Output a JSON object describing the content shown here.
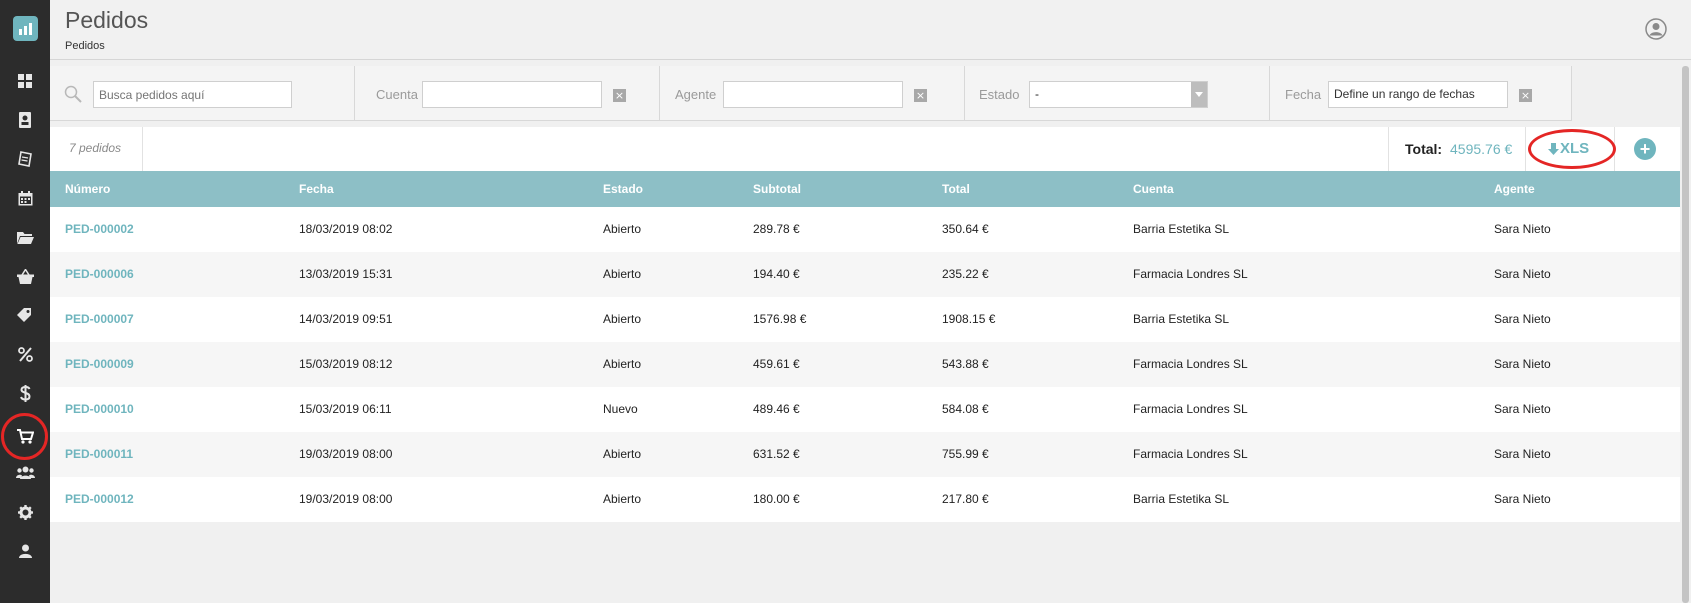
{
  "header": {
    "title": "Pedidos",
    "subtitle": "Pedidos"
  },
  "sidebar": {
    "items": [
      {
        "icon": "dashboard-icon"
      },
      {
        "icon": "contacts-icon"
      },
      {
        "icon": "notes-icon"
      },
      {
        "icon": "calendar-icon"
      },
      {
        "icon": "folder-icon"
      },
      {
        "icon": "basket-icon"
      },
      {
        "icon": "tag-icon"
      },
      {
        "icon": "percent-icon"
      },
      {
        "icon": "dollar-icon"
      },
      {
        "icon": "cart-icon",
        "active": true
      },
      {
        "icon": "users-icon"
      },
      {
        "icon": "gear-icon"
      },
      {
        "icon": "person-icon"
      }
    ]
  },
  "filters": {
    "search_placeholder": "Busca pedidos aquí",
    "cuenta_label": "Cuenta",
    "cuenta_value": "",
    "agente_label": "Agente",
    "agente_value": "",
    "estado_label": "Estado",
    "estado_value": "-",
    "fecha_label": "Fecha",
    "fecha_value": "Define un rango de fechas"
  },
  "summary": {
    "count": "7 pedidos",
    "total_label": "Total:",
    "total_value": "4595.76 €",
    "xls_label": "XLS",
    "add_label": "+"
  },
  "table": {
    "headers": [
      "Número",
      "Fecha",
      "Estado",
      "Subtotal",
      "Total",
      "Cuenta",
      "Agente"
    ],
    "rows": [
      [
        "PED-000002",
        "18/03/2019 08:02",
        "Abierto",
        "289.78 €",
        "350.64 €",
        "Barria Estetika SL",
        "Sara Nieto"
      ],
      [
        "PED-000006",
        "13/03/2019 15:31",
        "Abierto",
        "194.40 €",
        "235.22 €",
        "Farmacia Londres SL",
        "Sara Nieto"
      ],
      [
        "PED-000007",
        "14/03/2019 09:51",
        "Abierto",
        "1576.98 €",
        "1908.15 €",
        "Barria Estetika SL",
        "Sara Nieto"
      ],
      [
        "PED-000009",
        "15/03/2019 08:12",
        "Abierto",
        "459.61 €",
        "543.88 €",
        "Farmacia Londres SL",
        "Sara Nieto"
      ],
      [
        "PED-000010",
        "15/03/2019 06:11",
        "Nuevo",
        "489.46 €",
        "584.08 €",
        "Farmacia Londres SL",
        "Sara Nieto"
      ],
      [
        "PED-000011",
        "19/03/2019 08:00",
        "Abierto",
        "631.52 €",
        "755.99 €",
        "Farmacia Londres SL",
        "Sara Nieto"
      ],
      [
        "PED-000012",
        "19/03/2019 08:00",
        "Abierto",
        "180.00 €",
        "217.80 €",
        "Barria Estetika SL",
        "Sara Nieto"
      ]
    ]
  },
  "colors": {
    "accent": "#6fb5be",
    "table_header": "#8dbfc6",
    "sidebar": "#2c2c2c",
    "highlight_ring": "#e42625"
  }
}
